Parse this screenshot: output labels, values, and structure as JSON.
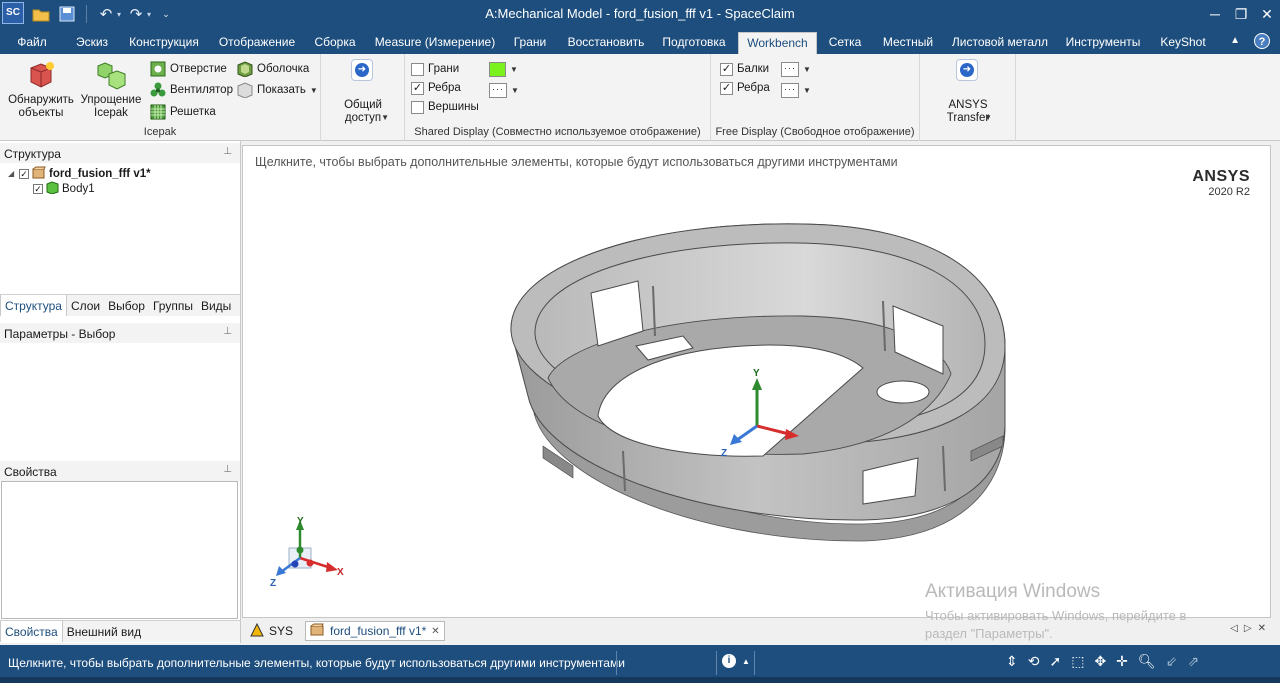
{
  "window": {
    "app_logo": "SC",
    "title": "A:Mechanical Model - ford_fusion_fff v1 - SpaceClaim",
    "controls": [
      "minimize-icon",
      "restore-icon",
      "close-icon"
    ]
  },
  "quick_access": [
    "open-folder-icon",
    "save-icon",
    "undo-icon",
    "redo-icon",
    "customize-icon"
  ],
  "tabs": [
    {
      "label": "Файл"
    },
    {
      "label": "Эскиз"
    },
    {
      "label": "Конструкция"
    },
    {
      "label": "Отображение"
    },
    {
      "label": "Сборка"
    },
    {
      "label": "Measure (Измерение)"
    },
    {
      "label": "Грани"
    },
    {
      "label": "Восстановить"
    },
    {
      "label": "Подготовка"
    },
    {
      "label": "Workbench",
      "active": true
    },
    {
      "label": "Сетка"
    },
    {
      "label": "Местный"
    },
    {
      "label": "Листовой металл"
    },
    {
      "label": "Инструменты"
    },
    {
      "label": "KeyShot"
    }
  ],
  "ribbon": {
    "icepak": {
      "label": "Icepak",
      "detect": "Обнаружить объекты",
      "simplify": "Упрощение Icepak",
      "hole": "Отверстие",
      "fan": "Вентилятор",
      "grille": "Решетка",
      "shell": "Оболочка",
      "show": "Показать"
    },
    "share": {
      "label": "Общий доступ"
    },
    "shared_display": {
      "label": "Shared Display (Совместно используемое отображение)",
      "faces": {
        "label": "Грани",
        "checked": false,
        "color": "#7cf21d"
      },
      "edges": {
        "label": "Ребра",
        "checked": true
      },
      "vertices": {
        "label": "Вершины",
        "checked": false
      }
    },
    "free_display": {
      "label": "Free Display (Свободное отображение)",
      "beams": {
        "label": "Балки",
        "checked": true
      },
      "edges": {
        "label": "Ребра",
        "checked": true
      }
    },
    "ansys_transfer": {
      "label": "ANSYS Transfer"
    }
  },
  "structure": {
    "title": "Структура",
    "tree": [
      {
        "label": "ford_fusion_fff v1*",
        "checked": true,
        "icon": "assembly-icon"
      },
      {
        "label": "Body1",
        "checked": true,
        "icon": "body-icon"
      }
    ],
    "tabs": [
      {
        "label": "Структура",
        "active": true
      },
      {
        "label": "Слои"
      },
      {
        "label": "Выбор"
      },
      {
        "label": "Группы"
      },
      {
        "label": "Виды"
      }
    ]
  },
  "selection_params": {
    "title": "Параметры - Выбор"
  },
  "properties": {
    "title": "Свойства",
    "tabs": [
      {
        "label": "Свойства",
        "active": true
      },
      {
        "label": "Внешний вид"
      }
    ]
  },
  "viewport": {
    "hint": "Щелкните, чтобы выбрать дополнительные элементы, которые будут использоваться другими инструментами",
    "brand": "ANSYS",
    "version": "2020 R2",
    "axis_x": "X",
    "axis_y": "Y",
    "axis_z": "Z"
  },
  "doc_tabs": [
    {
      "label": "SYS",
      "icon": "ansys-icon"
    },
    {
      "label": "ford_fusion_fff v1*",
      "icon": "part-icon",
      "active": true
    }
  ],
  "watermark": {
    "title": "Активация Windows",
    "line1": "Чтобы активировать Windows, перейдите в",
    "line2": "раздел \"Параметры\"."
  },
  "status": {
    "text": "Щелкните, чтобы выбрать дополнительные элементы, которые будут использоваться другими инструментами"
  }
}
